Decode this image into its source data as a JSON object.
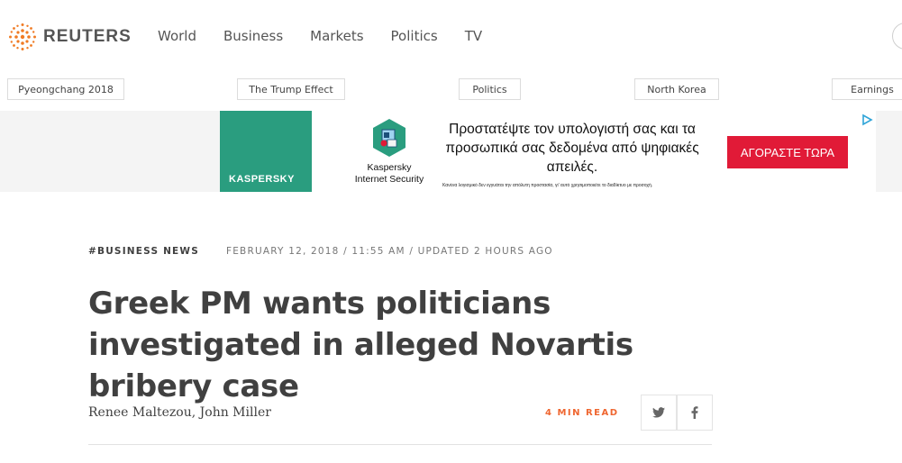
{
  "header": {
    "brand": "REUTERS",
    "nav": [
      "World",
      "Business",
      "Markets",
      "Politics",
      "TV"
    ]
  },
  "trending": [
    "Pyeongchang 2018",
    "The Trump Effect",
    "Politics",
    "North Korea",
    "Earnings"
  ],
  "ad": {
    "brand_logo": "KASPERSKY",
    "product_line1": "Kaspersky",
    "product_line2": "Internet Security",
    "headline": "Προστατέψτε τον υπολογιστή σας και τα προσωπικά σας δεδομένα από ψηφιακές απειλές.",
    "fine_print": "Κανένα λογισμικό δεν εγγυάται την απόλυτη προστασία, γι' αυτό χρησιμοποιείτε το διαδίκτυο με προσοχή.",
    "cta": "ΑΓΟΡΑΣΤΕ ΤΩΡΑ",
    "cta_color": "#e11a37",
    "accent_color": "#2a9d7f"
  },
  "article": {
    "section_tag": "#BUSINESS NEWS",
    "dateline": "FEBRUARY 12, 2018 / 11:55 AM / UPDATED 2 HOURS AGO",
    "headline": "Greek PM wants politicians investigated in alleged Novartis bribery case",
    "byline": "Renee Maltezou, John Miller",
    "read_time": "4 MIN READ",
    "read_time_color": "#ef6630",
    "share_icons": [
      "twitter-icon",
      "facebook-icon"
    ]
  },
  "colors": {
    "brand_orange": "#f07b24",
    "text": "#404040"
  }
}
